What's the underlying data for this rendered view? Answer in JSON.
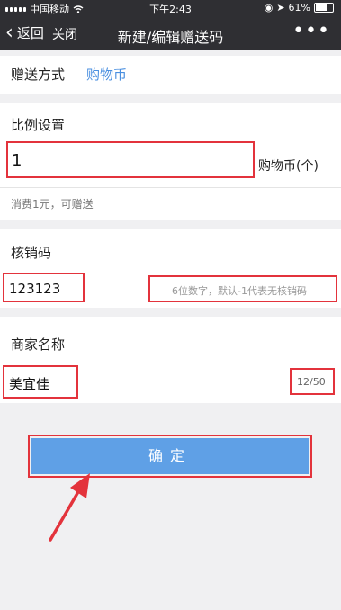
{
  "statusbar": {
    "carrier": "中国移动",
    "wifi_icon": "wifi-icon",
    "time": "下午2:43",
    "battery": "61%"
  },
  "navbar": {
    "back_label": "返回",
    "close_label": "关闭",
    "title": "新建/编辑赠送码",
    "more_label": "•••"
  },
  "gift_method": {
    "label": "赠送方式",
    "value": "购物币"
  },
  "ratio": {
    "label": "比例设置",
    "input_value": "1",
    "unit": "购物币(个)",
    "note": "消费1元，可赠送"
  },
  "verify_code": {
    "label": "核销码",
    "input_value": "123123",
    "hint": "6位数字，默认-1代表无核销码"
  },
  "merchant": {
    "label": "商家名称",
    "input_value": "美宜佳",
    "counter": "12/50"
  },
  "confirm_label": "确定",
  "colors": {
    "header_bg": "#2f2f33",
    "highlight": "#e3333c",
    "button": "#5fa0e6",
    "link_blue": "#4a8fe0"
  }
}
